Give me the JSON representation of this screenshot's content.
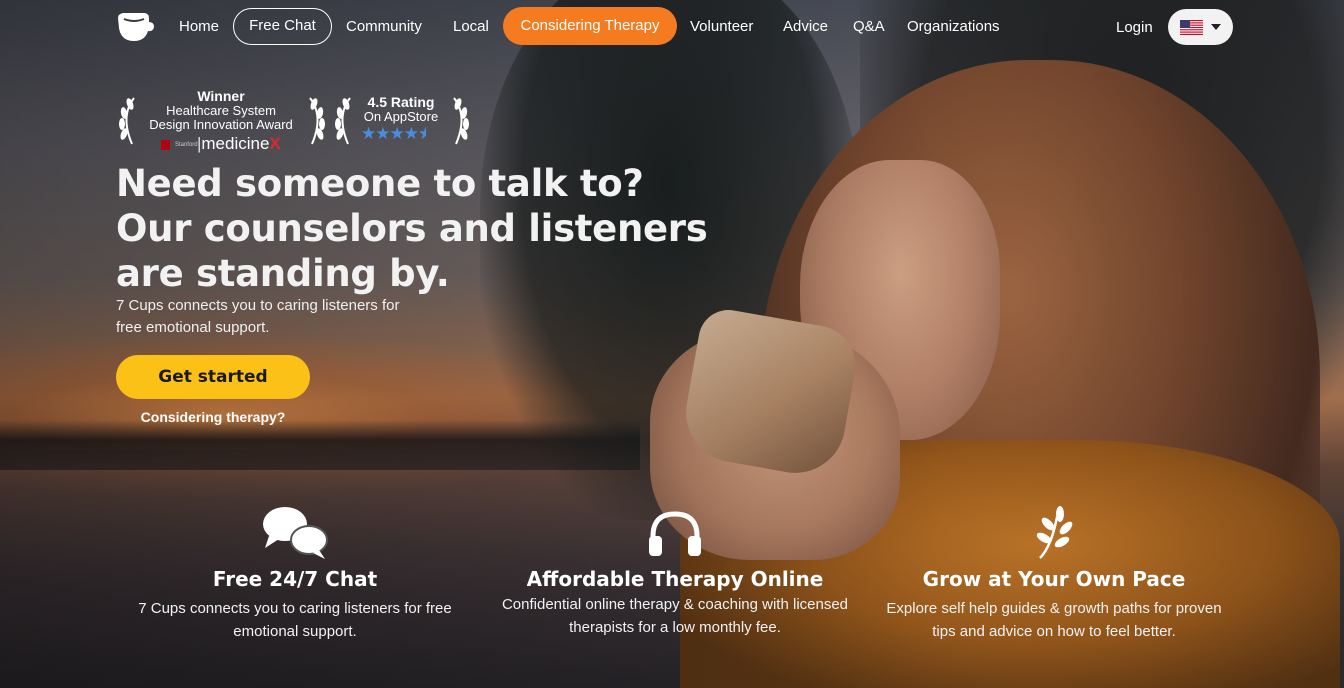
{
  "nav": {
    "links": [
      {
        "label": "Home"
      },
      {
        "label": "Free Chat"
      },
      {
        "label": "Community"
      },
      {
        "label": "Local"
      },
      {
        "label": "Considering Therapy"
      },
      {
        "label": "Volunteer"
      },
      {
        "label": "Advice"
      },
      {
        "label": "Q&A"
      },
      {
        "label": "Organizations"
      }
    ],
    "login_label": "Login",
    "language_flag": "us-flag-icon"
  },
  "awards": {
    "winner": {
      "title": "Winner",
      "line1": "Healthcare System",
      "line2": "Design Innovation Award",
      "sponsor_logo": "Stanford Medicine X",
      "sponsor_mark": "medicine",
      "sponsor_x": "X"
    },
    "rating": {
      "title": "4.5 Rating",
      "subtitle": "On AppStore",
      "stars": 4.5
    }
  },
  "hero": {
    "title_lines": [
      "Need someone to talk to?",
      "Our counselors and listeners",
      "are standing by."
    ],
    "subtitle": "7 Cups connects you to caring listeners for free emotional support.",
    "cta_label": "Get started",
    "secondary_link": "Considering therapy?"
  },
  "features": [
    {
      "icon": "chat-bubbles-icon",
      "title": "Free 24/7 Chat",
      "description": "7 Cups connects you to caring listeners for free emotional support."
    },
    {
      "icon": "headphones-icon",
      "title": "Affordable Therapy Online",
      "description": "Confidential online therapy & coaching with licensed therapists for a low monthly fee."
    },
    {
      "icon": "sprout-icon",
      "title": "Grow at Your Own Pace",
      "description": "Explore self help guides & growth paths for proven tips and advice on how to feel better."
    }
  ],
  "colors": {
    "accent_orange": "#f47b20",
    "cta_yellow": "#fcc117",
    "star_blue": "#4a8de0"
  }
}
